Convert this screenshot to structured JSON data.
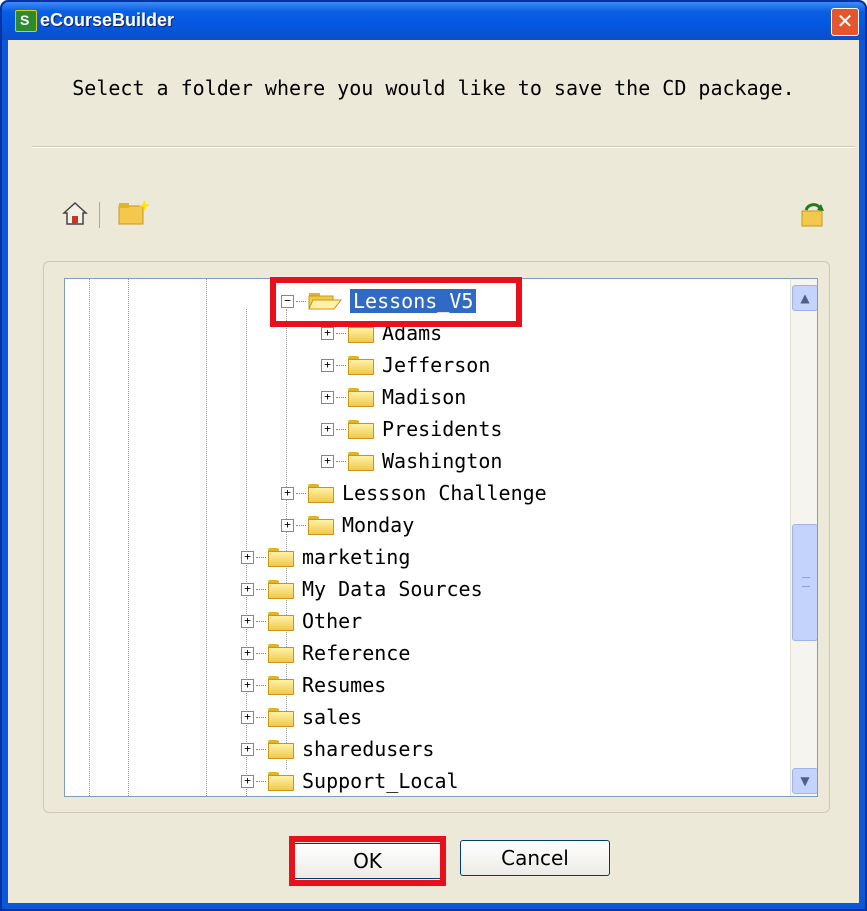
{
  "window": {
    "title": "eCourseBuilder",
    "app_icon_letter": "S",
    "close_glyph": "✕"
  },
  "prompt": "Select a folder where you would like to save the CD package.",
  "toolbar": {
    "home_icon": "home-icon",
    "new_folder_icon": "new-folder-icon",
    "refresh_icon": "refresh-icon"
  },
  "tree": {
    "selected": "Lessons_V5",
    "nodes": [
      {
        "label": "Lessons_V5",
        "expander": "−",
        "open": true
      },
      {
        "label": "Adams",
        "expander": "+"
      },
      {
        "label": "Jefferson",
        "expander": "+"
      },
      {
        "label": "Madison",
        "expander": "+"
      },
      {
        "label": "Presidents",
        "expander": "+"
      },
      {
        "label": "Washington",
        "expander": "+"
      },
      {
        "label": "Lessson Challenge",
        "expander": "+"
      },
      {
        "label": "Monday",
        "expander": "+"
      },
      {
        "label": "marketing",
        "expander": "+"
      },
      {
        "label": "My Data Sources",
        "expander": "+"
      },
      {
        "label": "Other",
        "expander": "+"
      },
      {
        "label": "Reference",
        "expander": "+"
      },
      {
        "label": "Resumes",
        "expander": "+"
      },
      {
        "label": "sales",
        "expander": "+"
      },
      {
        "label": "sharedusers",
        "expander": "+"
      },
      {
        "label": "Support_Local",
        "expander": "+"
      }
    ]
  },
  "scrollbar": {
    "up_glyph": "▲",
    "down_glyph": "▼"
  },
  "buttons": {
    "ok": "OK",
    "cancel": "Cancel"
  },
  "colors": {
    "highlight": "#e8101c",
    "selection": "#316ac5",
    "titlebar": "#0a5fe3"
  }
}
